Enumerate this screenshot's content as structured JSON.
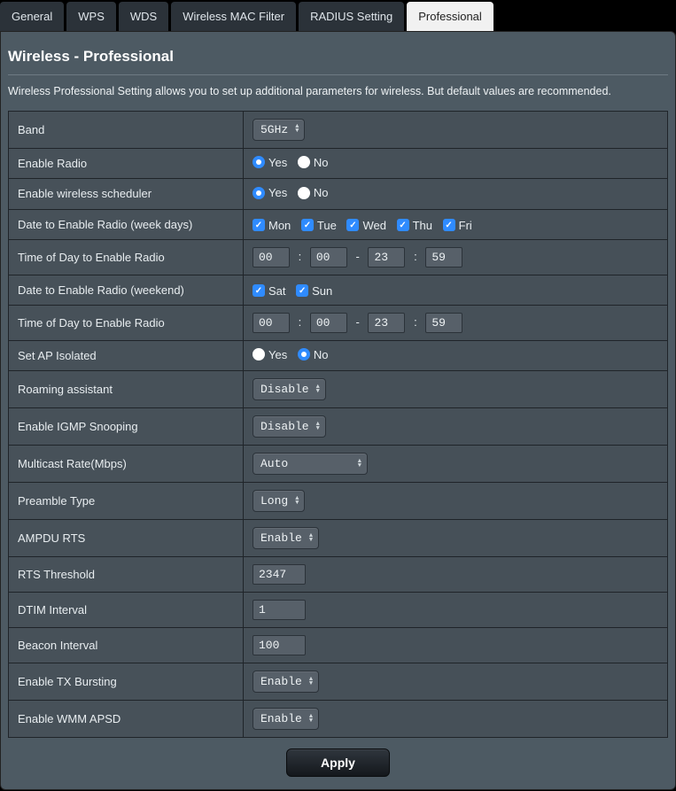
{
  "tabs": {
    "general": "General",
    "wps": "WPS",
    "wds": "WDS",
    "mac_filter": "Wireless MAC Filter",
    "radius": "RADIUS Setting",
    "professional": "Professional"
  },
  "page": {
    "title": "Wireless - Professional",
    "description": "Wireless Professional Setting allows you to set up additional parameters for wireless. But default values are recommended."
  },
  "labels": {
    "band": "Band",
    "enable_radio": "Enable Radio",
    "enable_scheduler": "Enable wireless scheduler",
    "date_week": "Date to Enable Radio (week days)",
    "time_week": "Time of Day to Enable Radio",
    "date_weekend": "Date to Enable Radio (weekend)",
    "time_weekend": "Time of Day to Enable Radio",
    "ap_isolated": "Set AP Isolated",
    "roaming": "Roaming assistant",
    "igmp": "Enable IGMP Snooping",
    "multicast": "Multicast Rate(Mbps)",
    "preamble": "Preamble Type",
    "ampdu": "AMPDU RTS",
    "rts": "RTS Threshold",
    "dtim": "DTIM Interval",
    "beacon": "Beacon Interval",
    "tx_burst": "Enable TX Bursting",
    "wmm": "Enable WMM APSD"
  },
  "options": {
    "yes": "Yes",
    "no": "No",
    "mon": "Mon",
    "tue": "Tue",
    "wed": "Wed",
    "thu": "Thu",
    "fri": "Fri",
    "sat": "Sat",
    "sun": "Sun"
  },
  "values": {
    "band": "5GHz",
    "enable_radio": "yes",
    "enable_scheduler": "yes",
    "week_days": {
      "mon": true,
      "tue": true,
      "wed": true,
      "thu": true,
      "fri": true
    },
    "time_week": {
      "h1": "00",
      "m1": "00",
      "h2": "23",
      "m2": "59"
    },
    "weekend_days": {
      "sat": true,
      "sun": true
    },
    "time_weekend": {
      "h1": "00",
      "m1": "00",
      "h2": "23",
      "m2": "59"
    },
    "ap_isolated": "no",
    "roaming": "Disable",
    "igmp": "Disable",
    "multicast": "Auto",
    "preamble": "Long",
    "ampdu": "Enable",
    "rts": "2347",
    "dtim": "1",
    "beacon": "100",
    "tx_burst": "Enable",
    "wmm": "Enable"
  },
  "buttons": {
    "apply": "Apply"
  }
}
